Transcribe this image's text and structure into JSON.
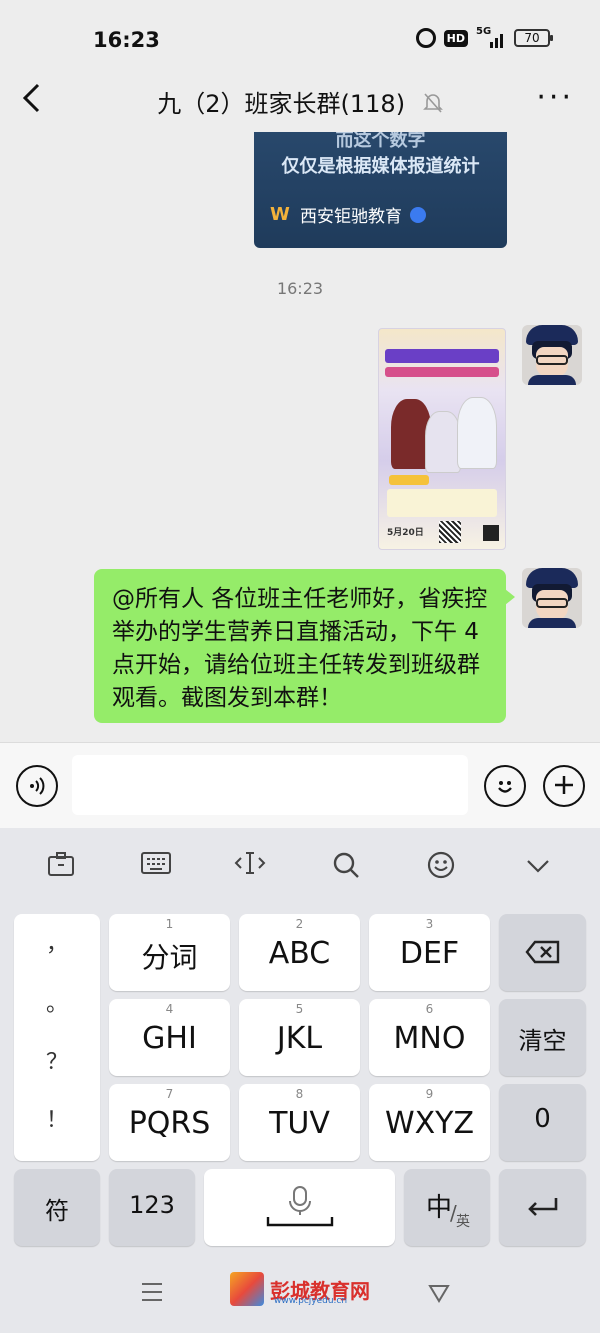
{
  "status_bar": {
    "time": "16:23",
    "network": "5G",
    "hd": "HD",
    "battery": "70"
  },
  "header": {
    "title": "九（2）班家长群(118)",
    "back_icon": "chevron-left-icon",
    "more_label": "···"
  },
  "chat": {
    "shared_card": {
      "line1": "而这个数字",
      "line2": "仅仅是根据媒体报道统计",
      "source": "西安钜驰教育"
    },
    "timestamp": "16:23",
    "poster": {
      "date": "5月20日"
    },
    "message_text": "@所有人   各位班主任老师好，省疾控举办的学生营养日直播活动，下午 4 点开始，请给位班主任转发到班级群观看。截图发到本群！"
  },
  "input_bar": {
    "text": ""
  },
  "keyboard": {
    "keys": [
      {
        "num": "1",
        "label": "分词"
      },
      {
        "num": "2",
        "label": "ABC"
      },
      {
        "num": "3",
        "label": "DEF"
      },
      {
        "num": "4",
        "label": "GHI"
      },
      {
        "num": "5",
        "label": "JKL"
      },
      {
        "num": "6",
        "label": "MNO"
      },
      {
        "num": "7",
        "label": "PQRS"
      },
      {
        "num": "8",
        "label": "TUV"
      },
      {
        "num": "9",
        "label": "WXYZ"
      }
    ],
    "symbols": [
      "，",
      "。",
      "？",
      "！"
    ],
    "clear_label": "清空",
    "zero_label": "0",
    "fu_label": "符",
    "num_label": "123",
    "lang_main": "中",
    "lang_sub": "英"
  },
  "watermark": {
    "name": "彭城教育网",
    "url": "www.pcjyedu.cn"
  }
}
